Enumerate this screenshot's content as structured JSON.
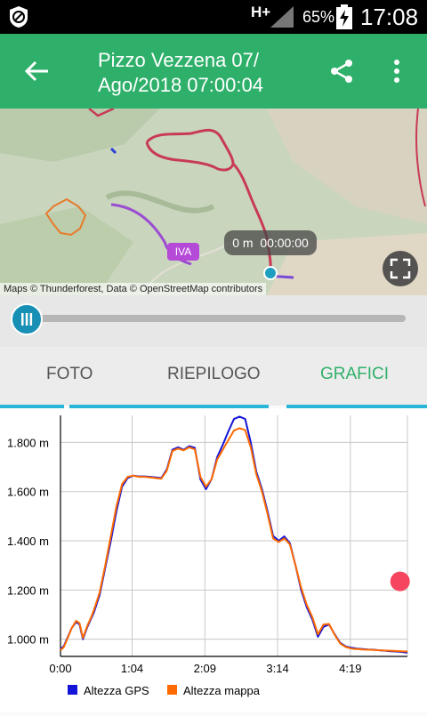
{
  "status": {
    "network": "H+",
    "battery": "65%",
    "time": "17:08"
  },
  "header": {
    "title_line1": "Pizzo Vezzena 07/",
    "title_line2": "Ago/2018 07:00:04"
  },
  "map": {
    "attribution": "Maps © Thunderforest, Data © OpenStreetMap contributors",
    "info_distance": "0 m",
    "info_time": "00:00:00",
    "road_label": "IVA"
  },
  "slider": {
    "progress": 0
  },
  "tabs": [
    {
      "label": "FOTO",
      "active": false
    },
    {
      "label": "RIEPILOGO",
      "active": false
    },
    {
      "label": "GRAFICI",
      "active": true
    }
  ],
  "colors": {
    "accent": "#2fb06a",
    "gps_series": "#1414d8",
    "map_series": "#ff6a00",
    "marker": "#f5455f"
  },
  "chart_data": {
    "type": "line",
    "x_ticks": [
      "0:00",
      "1:04",
      "2:09",
      "3:14",
      "4:19"
    ],
    "y_ticks": [
      "1.000 m",
      "1.200 m",
      "1.400 m",
      "1.600 m",
      "1.800 m"
    ],
    "x_unit": "minutes",
    "xlim": [
      0,
      310
    ],
    "ylim": [
      930,
      1910
    ],
    "grid": true,
    "legend_position": "bottom",
    "series": [
      {
        "name": "Altezza GPS",
        "x": [
          0,
          3,
          6,
          10,
          14,
          17,
          20,
          24,
          27,
          30,
          35,
          40,
          45,
          50,
          55,
          60,
          65,
          70,
          75,
          80,
          85,
          90,
          95,
          100,
          105,
          110,
          115,
          120,
          125,
          130,
          135,
          140,
          145,
          150,
          155,
          160,
          165,
          170,
          175,
          180,
          185,
          190,
          195,
          200,
          205,
          210,
          215,
          220,
          225,
          230,
          235,
          240,
          245,
          250,
          255,
          260,
          265,
          270,
          275,
          280,
          285,
          290,
          295,
          300,
          305,
          310
        ],
        "y": [
          960,
          972,
          1003,
          1045,
          1070,
          1060,
          1000,
          1050,
          1080,
          1110,
          1180,
          1290,
          1400,
          1520,
          1620,
          1655,
          1665,
          1662,
          1662,
          1660,
          1658,
          1655,
          1690,
          1770,
          1780,
          1770,
          1785,
          1778,
          1650,
          1610,
          1650,
          1740,
          1790,
          1845,
          1895,
          1905,
          1895,
          1800,
          1680,
          1610,
          1520,
          1420,
          1400,
          1418,
          1390,
          1300,
          1200,
          1130,
          1080,
          1010,
          1050,
          1060,
          1020,
          985,
          970,
          965,
          962,
          960,
          958,
          957,
          955,
          953,
          951,
          950,
          948,
          945
        ]
      },
      {
        "name": "Altezza mappa",
        "x": [
          0,
          3,
          6,
          10,
          14,
          17,
          20,
          24,
          27,
          30,
          35,
          40,
          45,
          50,
          55,
          60,
          65,
          70,
          75,
          80,
          85,
          90,
          95,
          100,
          105,
          110,
          115,
          120,
          125,
          130,
          135,
          140,
          145,
          150,
          155,
          160,
          165,
          170,
          175,
          180,
          185,
          190,
          195,
          200,
          205,
          210,
          215,
          220,
          225,
          230,
          235,
          240,
          245,
          250,
          255,
          260,
          265,
          270,
          275,
          280,
          285,
          290,
          295,
          300,
          305,
          310
        ],
        "y": [
          955,
          968,
          1000,
          1045,
          1075,
          1065,
          1005,
          1055,
          1085,
          1120,
          1190,
          1300,
          1420,
          1540,
          1630,
          1660,
          1665,
          1660,
          1660,
          1658,
          1655,
          1652,
          1685,
          1765,
          1775,
          1768,
          1780,
          1772,
          1660,
          1620,
          1650,
          1730,
          1770,
          1810,
          1848,
          1858,
          1850,
          1780,
          1670,
          1600,
          1510,
          1410,
          1395,
          1410,
          1385,
          1300,
          1210,
          1140,
          1090,
          1020,
          1060,
          1062,
          1018,
          982,
          968,
          962,
          960,
          958,
          957,
          956,
          955,
          954,
          953,
          952,
          951,
          950
        ]
      }
    ],
    "marker": {
      "x": 305,
      "y": 1235
    }
  }
}
